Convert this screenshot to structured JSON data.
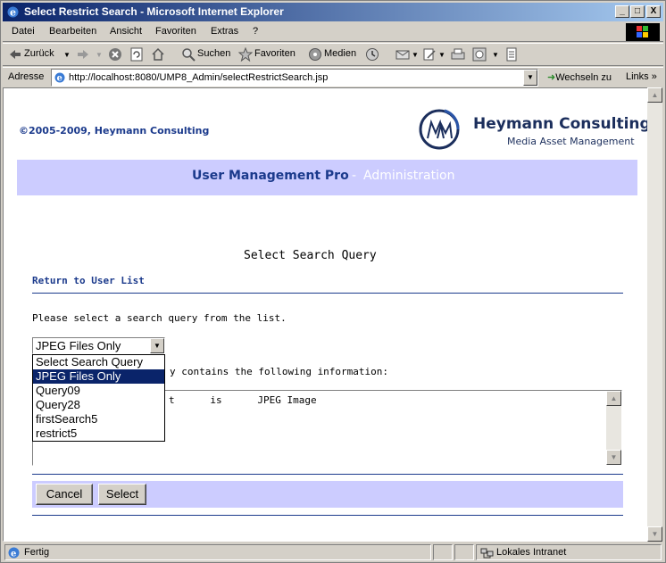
{
  "window": {
    "title": "Select Restrict Search - Microsoft Internet Explorer",
    "minimize": "_",
    "maximize": "□",
    "close": "X"
  },
  "menu": [
    "Datei",
    "Bearbeiten",
    "Ansicht",
    "Favoriten",
    "Extras",
    "?"
  ],
  "toolbar": {
    "back": "Zurück",
    "search": "Suchen",
    "favorites": "Favoriten",
    "media": "Medien"
  },
  "address": {
    "label": "Adresse",
    "url": "http://localhost:8080/UMP8_Admin/selectRestrictSearch.jsp",
    "go": "Wechseln zu",
    "links": "Links"
  },
  "page": {
    "copyright": "©2005-2009, Heymann Consulting",
    "brand_name": "Heymann Consulting",
    "brand_sub": "Media Asset Management",
    "app_name": "User Management Pro",
    "separator": "-",
    "section": "Administration",
    "heading": "Select Search Query",
    "return_link": "Return to User List",
    "instruction": "Please select a search query from the list.",
    "selected_query": "JPEG Files Only",
    "info_text": "y contains the following information:",
    "query_line": "t      is      JPEG Image",
    "dropdown_options": [
      "Select Search Query",
      "JPEG Files Only",
      "Query09",
      "Query28",
      "firstSearch5",
      "restrict5"
    ],
    "cancel": "Cancel",
    "select": "Select"
  },
  "status": {
    "text": "Fertig",
    "zone": "Lokales Intranet"
  },
  "colors": {
    "brand_blue": "#1b3a8c",
    "banner_bg": "#ccccff",
    "selection": "#0a246a"
  }
}
